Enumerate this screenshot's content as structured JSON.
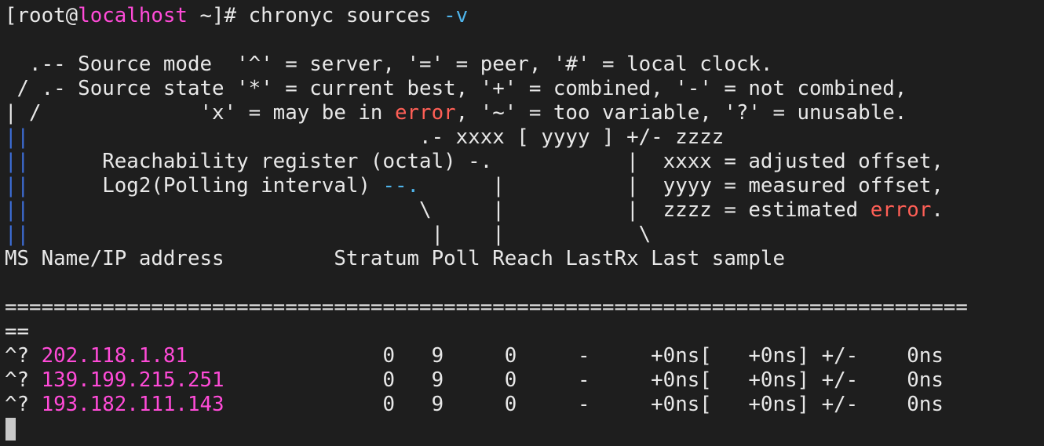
{
  "prompt": {
    "user": "root",
    "at": "@",
    "host": "localhost",
    "path_suffix": " ~]# ",
    "open_bracket": "[",
    "command": "chronyc sources ",
    "flag": "-v"
  },
  "legend": {
    "l1": "  .-- Source mode  '^' = server, '=' = peer, '#' = local clock.",
    "l2": " / .- Source state '*' = current best, '+' = combined, '-' = not combined,",
    "l3_bar": "|",
    "l3_a": " /             'x' = may be in ",
    "l3_err": "error",
    "l3_b": ", '~' = too variable, '?' = unusable.",
    "l4_bar": "||",
    "l4_text": "                                .- xxxx [ yyyy ] +/- zzzz",
    "l5_bar": "||",
    "l5_text": "      Reachability register (octal) -.           |  xxxx = adjusted offset,",
    "l6_bar": "||",
    "l6_a": "      Log2(Polling interval) ",
    "l6_dashes": "--.",
    "l6_b": "      |          |  yyyy = measured offset,",
    "l7_bar": "||",
    "l7_a": "                                \\     |          |  zzzz = estimated ",
    "l7_err": "error",
    "l7_b": ".",
    "l8_bar": "||",
    "l8_text": "                                 |    |           \\",
    "header": "MS Name/IP address         Stratum Poll Reach LastRx Last sample",
    "separator": "===============================================================================",
    "separator_wrap": "=="
  },
  "sources": [
    {
      "mode": "^?",
      "ip": "202.118.1.81",
      "rest": "                0   9     0     -     +0ns[   +0ns] +/-    0ns"
    },
    {
      "mode": "^?",
      "ip": "139.199.215.251",
      "rest": "             0   9     0     -     +0ns[   +0ns] +/-    0ns"
    },
    {
      "mode": "^?",
      "ip": "193.182.111.143",
      "rest": "             0   9     0     -     +0ns[   +0ns] +/-    0ns"
    }
  ]
}
